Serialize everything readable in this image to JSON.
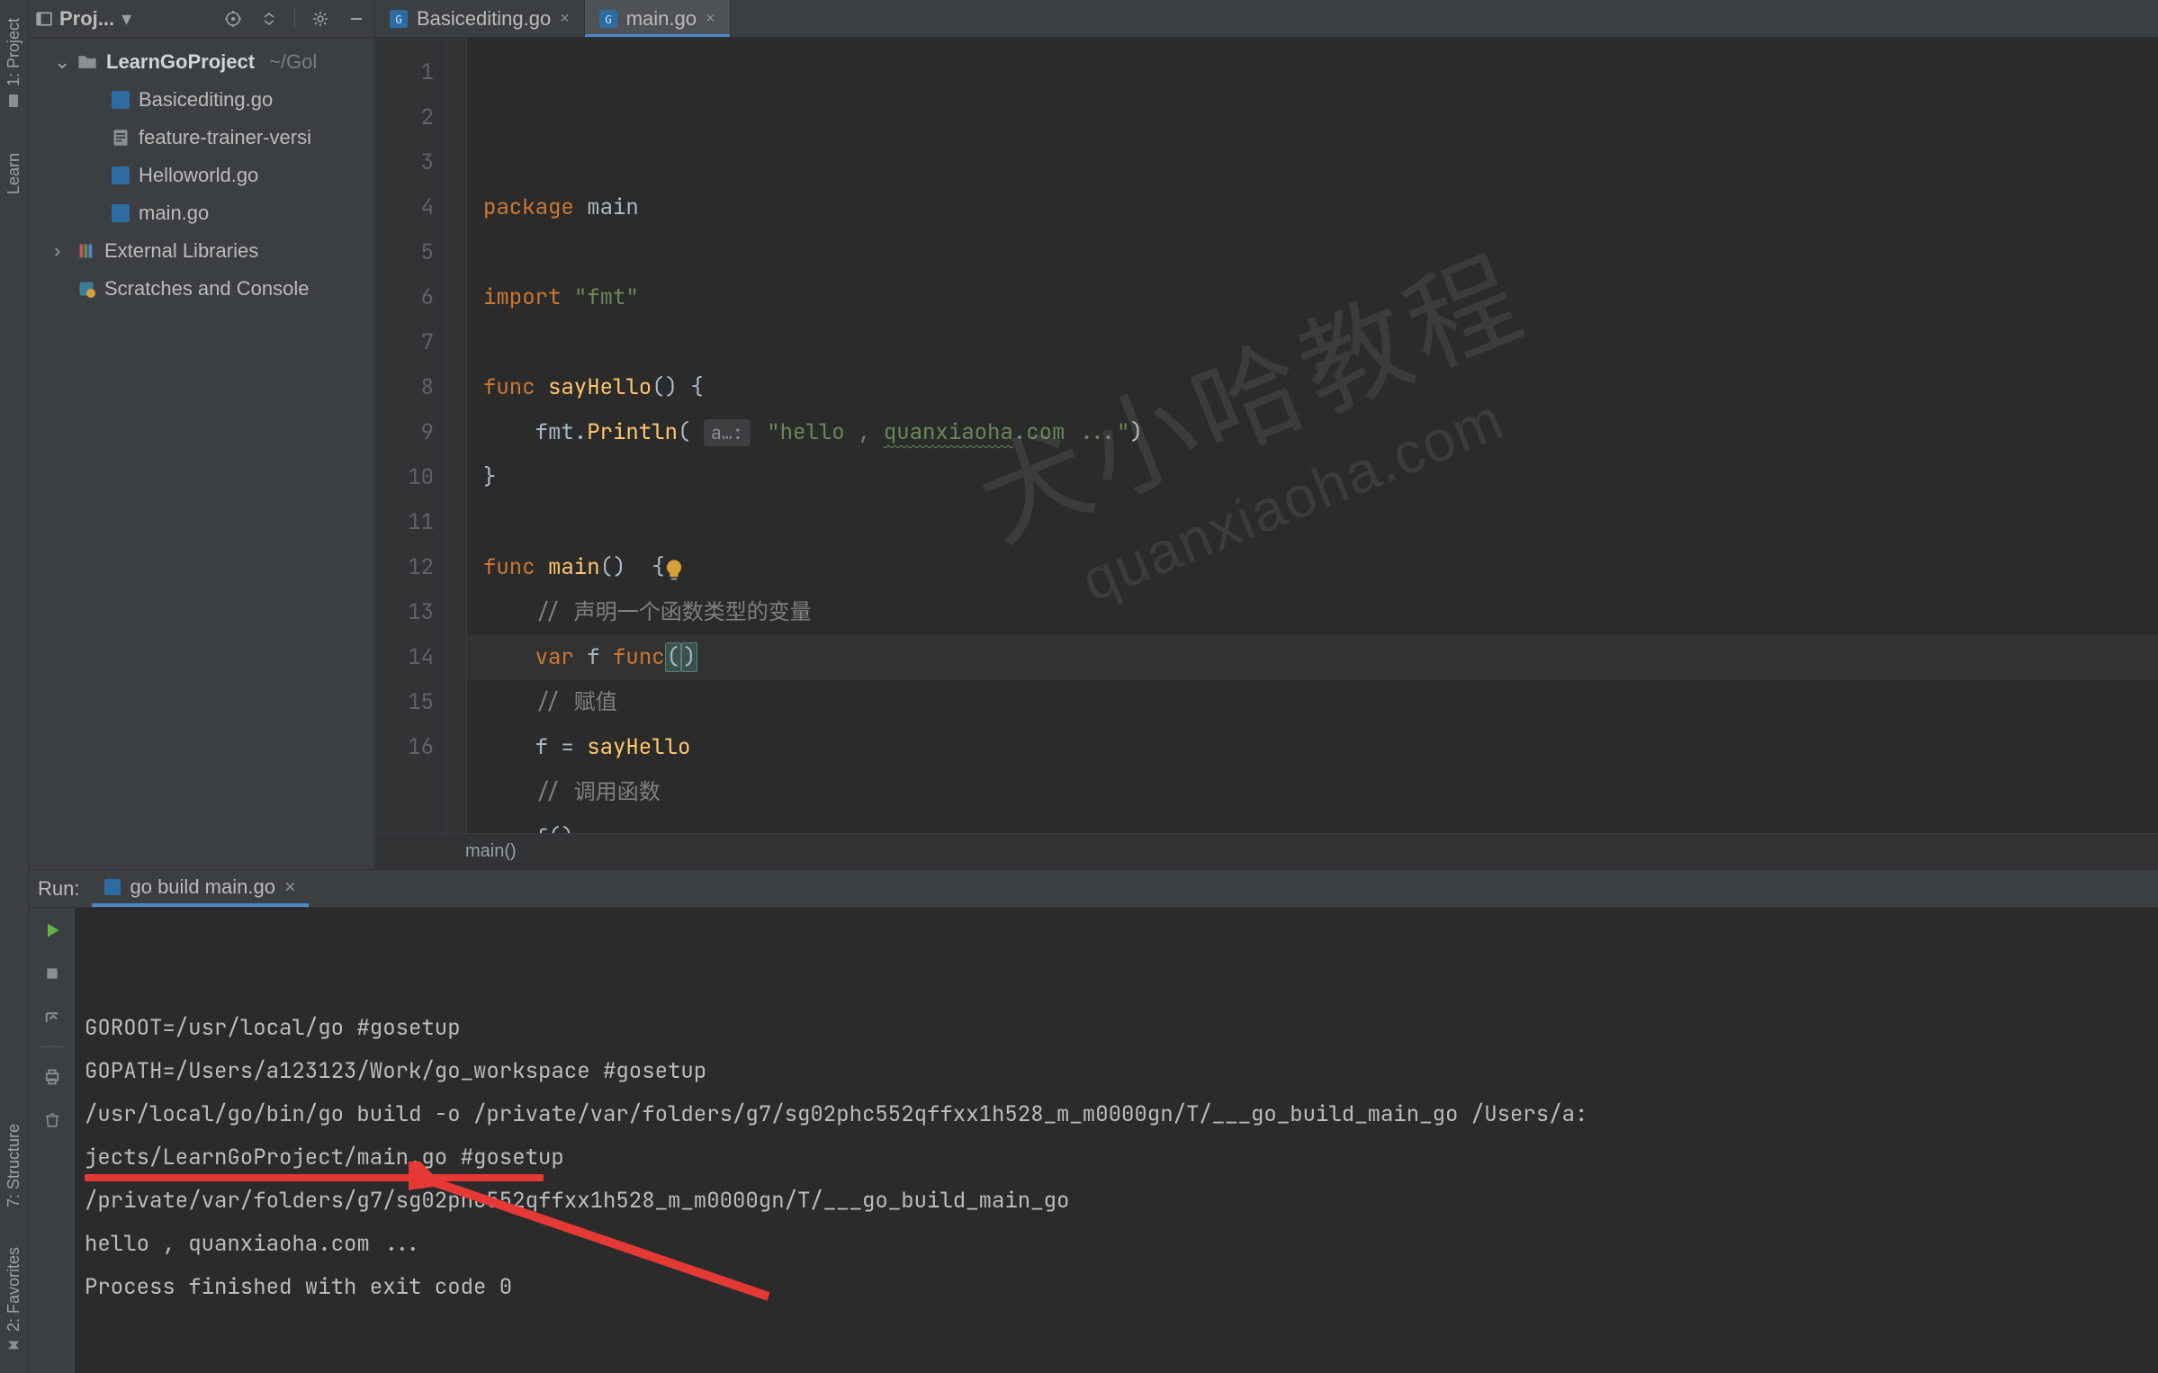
{
  "left_rail": {
    "top": [
      {
        "label": "1: Project",
        "icon": "folder-icon"
      },
      {
        "label": "Learn",
        "icon": "learn-icon"
      }
    ],
    "bottom": [
      {
        "label": "7: Structure",
        "icon": "structure-icon"
      },
      {
        "label": "2: Favorites",
        "icon": "favorites-icon"
      }
    ]
  },
  "project_toolbar": {
    "label": "Proj...",
    "icons": [
      "target-icon",
      "expand-all-icon",
      "divider",
      "gear-icon",
      "minimize-icon"
    ]
  },
  "editor_tabs": [
    {
      "label": "Basicediting.go",
      "icon": "go-file-icon",
      "active": false
    },
    {
      "label": "main.go",
      "icon": "go-file-icon",
      "active": true
    }
  ],
  "tree": {
    "root": {
      "name": "LearnGoProject",
      "path": "~/Gol"
    },
    "children": [
      {
        "name": "Basicediting.go",
        "icon": "go-file-icon"
      },
      {
        "name": "feature-trainer-versi",
        "icon": "text-file-icon"
      },
      {
        "name": "Helloworld.go",
        "icon": "go-file-icon"
      },
      {
        "name": "main.go",
        "icon": "go-file-icon"
      }
    ],
    "extra": [
      {
        "name": "External Libraries",
        "icon": "libraries-icon",
        "expandable": true
      },
      {
        "name": "Scratches and Console",
        "icon": "scratches-icon",
        "expandable": false
      }
    ]
  },
  "code": {
    "lines": [
      {
        "n": 1,
        "segments": [
          {
            "t": "package ",
            "c": "kw"
          },
          {
            "t": "main",
            "c": ""
          }
        ]
      },
      {
        "n": 2,
        "segments": []
      },
      {
        "n": 3,
        "segments": [
          {
            "t": "import ",
            "c": "kw"
          },
          {
            "t": "\"fmt\"",
            "c": "str"
          }
        ]
      },
      {
        "n": 4,
        "segments": []
      },
      {
        "n": 5,
        "segments": [
          {
            "t": "func ",
            "c": "kw"
          },
          {
            "t": "sayHello",
            "c": "fn"
          },
          {
            "t": "() {",
            "c": ""
          }
        ]
      },
      {
        "n": 6,
        "segments": [
          {
            "t": "    fmt.",
            "c": ""
          },
          {
            "t": "Println",
            "c": "fn"
          },
          {
            "t": "( ",
            "c": ""
          },
          {
            "t": "a…:",
            "c": "hint"
          },
          {
            "t": " \"hello , ",
            "c": "str"
          },
          {
            "t": "quanxiaoha",
            "c": "str underline"
          },
          {
            "t": ".com ...\"",
            "c": "str"
          },
          {
            "t": ")",
            "c": ""
          }
        ]
      },
      {
        "n": 7,
        "segments": [
          {
            "t": "}",
            "c": ""
          }
        ]
      },
      {
        "n": 8,
        "segments": []
      },
      {
        "n": 9,
        "segments": [
          {
            "t": "func ",
            "c": "kw"
          },
          {
            "t": "main",
            "c": "fn"
          },
          {
            "t": "()  {",
            "c": ""
          }
        ],
        "runmark": true
      },
      {
        "n": 10,
        "segments": [
          {
            "t": "    ",
            "c": ""
          },
          {
            "t": "// 声明一个函数类型的变量",
            "c": "cm"
          }
        ]
      },
      {
        "n": 11,
        "segments": [
          {
            "t": "    ",
            "c": ""
          },
          {
            "t": "var ",
            "c": "kw"
          },
          {
            "t": "f ",
            "c": ""
          },
          {
            "t": "func",
            "c": "kw"
          },
          {
            "t": "(",
            "c": "brace-match"
          },
          {
            "t": ")",
            "c": "brace-match"
          }
        ],
        "highlight": true,
        "bulb": true
      },
      {
        "n": 12,
        "segments": [
          {
            "t": "    ",
            "c": ""
          },
          {
            "t": "// 赋值",
            "c": "cm"
          }
        ]
      },
      {
        "n": 13,
        "segments": [
          {
            "t": "    f = ",
            "c": ""
          },
          {
            "t": "sayHello",
            "c": "fn"
          }
        ]
      },
      {
        "n": 14,
        "segments": [
          {
            "t": "    ",
            "c": ""
          },
          {
            "t": "// 调用函数",
            "c": "cm"
          }
        ]
      },
      {
        "n": 15,
        "segments": [
          {
            "t": "    f()",
            "c": ""
          }
        ]
      },
      {
        "n": 16,
        "segments": [
          {
            "t": "}",
            "c": ""
          }
        ]
      }
    ],
    "breadcrumb": "main()"
  },
  "watermark": {
    "cn": "犬小哈教程",
    "en": "quanxiaoha.com"
  },
  "run": {
    "title": "Run:",
    "tab": "go build main.go",
    "side_buttons": [
      "run-icon",
      "stop-icon",
      "layout-icon",
      "divider",
      "print-icon",
      "delete-icon"
    ],
    "output": [
      "GOROOT=/usr/local/go #gosetup",
      "GOPATH=/Users/a123123/Work/go_workspace #gosetup",
      "/usr/local/go/bin/go build -o /private/var/folders/g7/sg02phc552qffxx1h528_m_m0000gn/T/___go_build_main_go /Users/a:",
      "jects/LearnGoProject/main.go #gosetup",
      "/private/var/folders/g7/sg02phc552qffxx1h528_m_m0000gn/T/___go_build_main_go",
      "hello , quanxiaoha.com ...",
      "",
      "Process finished with exit code 0"
    ]
  }
}
